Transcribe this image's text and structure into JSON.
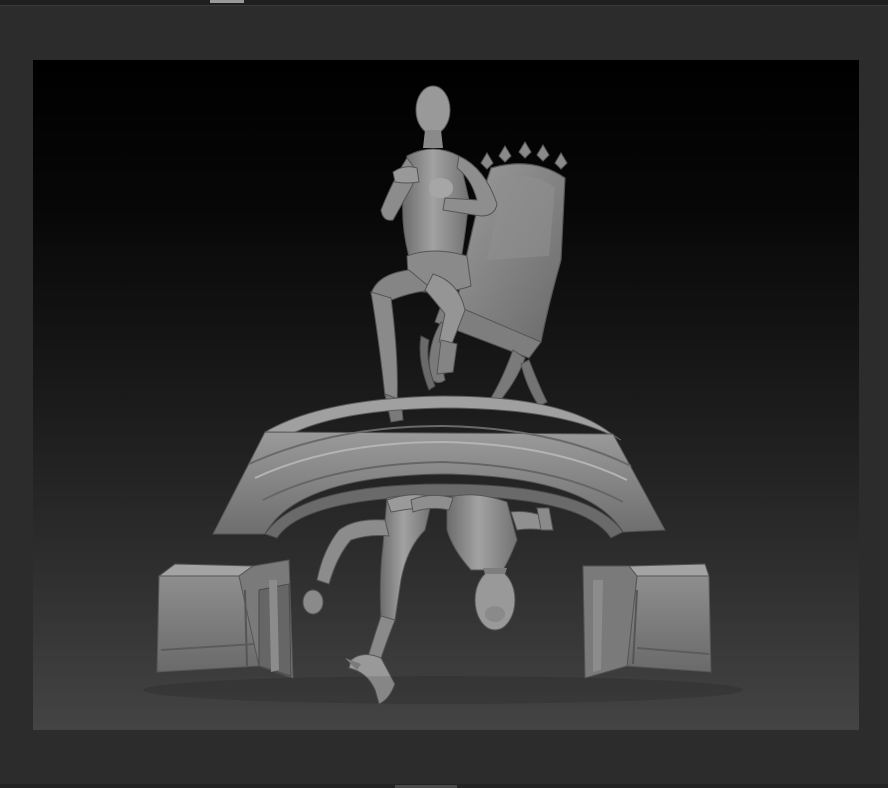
{
  "app": {
    "viewport": {
      "scene": "sculpt-model",
      "colors": {
        "frame": "#2c2c2c",
        "background_top": "#000000",
        "background_bottom": "#444444",
        "model_base": "#8a8a8a",
        "model_highlight": "#a8a8a8",
        "model_shadow": "#5c5c5c"
      }
    }
  }
}
